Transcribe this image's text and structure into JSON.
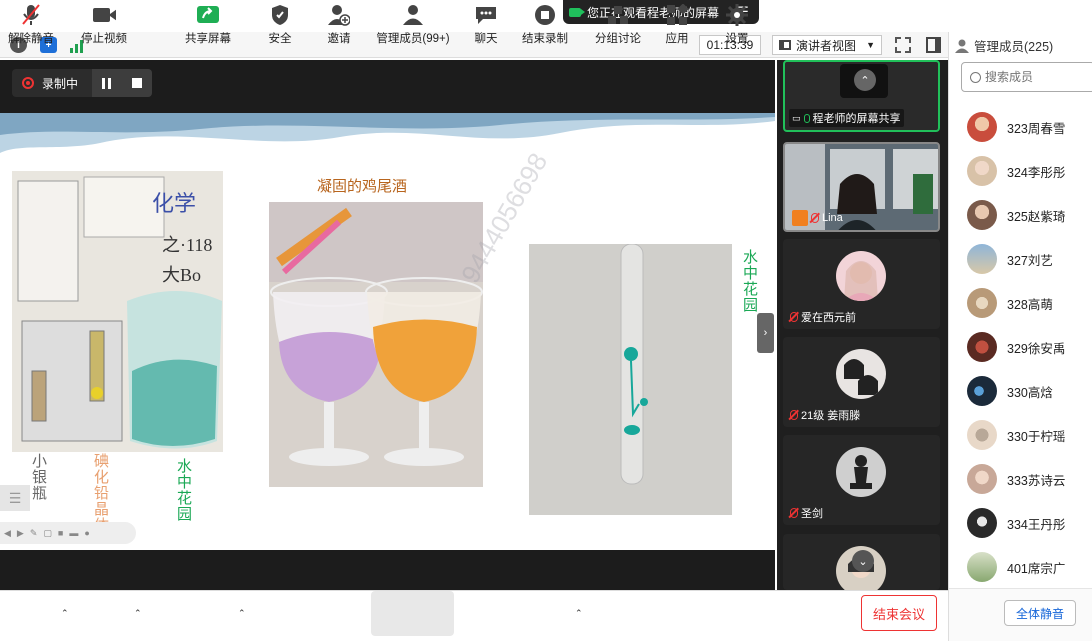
{
  "banner": {
    "text": "您正在观看程老师的屏幕"
  },
  "topbar": {
    "timer": "01:13:39",
    "view_label": "演讲者视图"
  },
  "recording": {
    "label": "录制中"
  },
  "slide": {
    "watermark": "9444056698",
    "title_middle": "凝固的鸡尾酒",
    "label_right": "水中花园",
    "label_mercury": "小银瓶",
    "label_iodine": "碘化铅晶体",
    "label_garden": "水中花园"
  },
  "gallery": {
    "tiles": [
      {
        "label": "程老师的屏幕共享"
      },
      {
        "label": "Lina"
      },
      {
        "label": "爱在西元前"
      },
      {
        "label": "21级 姜雨滕"
      },
      {
        "label": "圣剑"
      }
    ]
  },
  "members": {
    "header": "管理成员(225)",
    "search_placeholder": "搜索成员",
    "list": [
      {
        "name": "323周春雪",
        "color": "#c94d3c"
      },
      {
        "name": "324李彤彤",
        "color": "#d8c2a8"
      },
      {
        "name": "325赵紫琦",
        "color": "#7a5a4a"
      },
      {
        "name": "327刘艺",
        "color": "#8fb5d8"
      },
      {
        "name": "328高萌",
        "color": "#b89a78"
      },
      {
        "name": "329徐安禹",
        "color": "#5a2a22"
      },
      {
        "name": "330高焓",
        "color": "#1b2a3a"
      },
      {
        "name": "330于柠瑶",
        "color": "#e8d8c8"
      },
      {
        "name": "333苏诗云",
        "color": "#c8a898"
      },
      {
        "name": "334王丹彤",
        "color": "#2a2a2a"
      },
      {
        "name": "401席宗广",
        "color": "#88a870"
      }
    ],
    "mute_all": "全体静音"
  },
  "toolbar": {
    "unmute": "解除静音",
    "stop_video": "停止视频",
    "share": "共享屏幕",
    "security": "安全",
    "invite": "邀请",
    "manage": "管理成员(99+)",
    "chat": "聊天",
    "end_record": "结束录制",
    "breakout": "分组讨论",
    "apps": "应用",
    "settings": "设置",
    "end_meeting": "结束会议"
  }
}
